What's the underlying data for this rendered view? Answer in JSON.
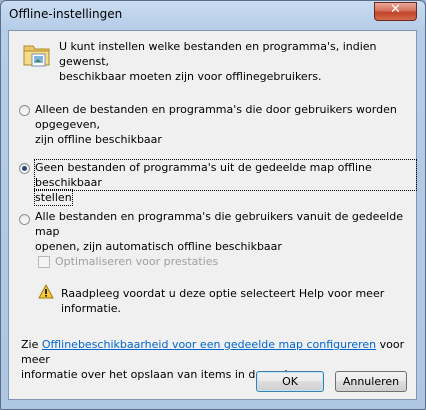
{
  "window": {
    "title": "Offline-instellingen",
    "close_glyph": "✕"
  },
  "intro": {
    "icon": "folder-offline-icon",
    "line1": "U kunt instellen welke bestanden en programma's, indien gewenst,",
    "line2": "beschikbaar moeten zijn voor offlinegebruikers."
  },
  "options": [
    {
      "line1": "Alleen de bestanden en programma's die door gebruikers worden opgegeven,",
      "line2": "zijn offline beschikbaar",
      "selected": false,
      "accesskey": "A"
    },
    {
      "line1": "Geen bestanden of programma's uit de gedeelde map offline beschikbaar",
      "line2": "stellen",
      "selected": true,
      "accesskey": "G"
    },
    {
      "line1": "Alle bestanden en programma's die gebruikers vanuit de gedeelde map",
      "line2": "openen, zijn automatisch offline beschikbaar",
      "selected": false,
      "accesskey": "A"
    }
  ],
  "optimize": {
    "label": "Optimaliseren voor prestaties",
    "checked": false,
    "enabled": false
  },
  "warning": {
    "icon": "warning-icon",
    "text": "Raadpleeg voordat u deze optie selecteert Help voor meer informatie."
  },
  "footer": {
    "prefix": "Zie ",
    "link": "Offlinebeschikbaarheid voor een gedeelde map configureren",
    "suffix": " voor meer",
    "line2": "informatie over het opslaan van items in de cache."
  },
  "buttons": {
    "ok": "OK",
    "cancel": "Annuleren"
  }
}
